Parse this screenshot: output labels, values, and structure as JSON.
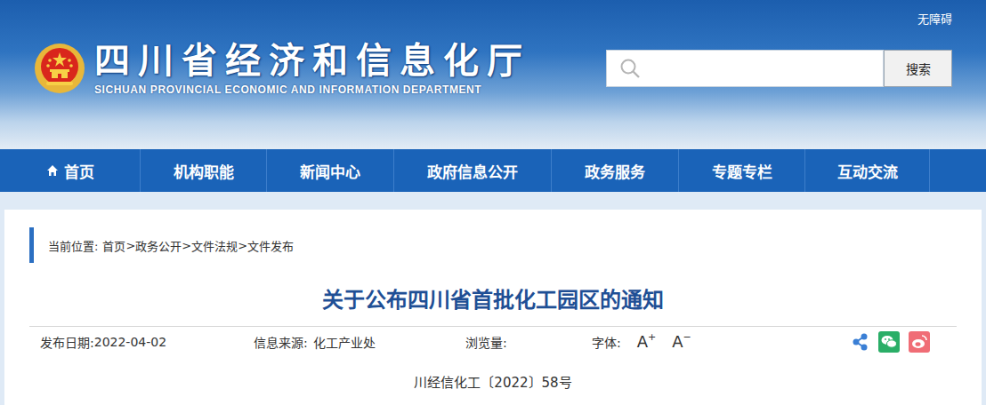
{
  "header": {
    "title": "四川省经济和信息化厅",
    "subtitle": "SICHUAN PROVINCIAL ECONOMIC AND INFORMATION DEPARTMENT",
    "accessibility": "无障碍",
    "search_button": "搜索"
  },
  "nav": {
    "items": [
      {
        "label": "首页",
        "kind": "home"
      },
      {
        "label": "机构职能",
        "kind": "text"
      },
      {
        "label": "新闻中心",
        "kind": "text"
      },
      {
        "label": "政府信息公开",
        "kind": "text"
      },
      {
        "label": "政务服务",
        "kind": "text"
      },
      {
        "label": "专题专栏",
        "kind": "text"
      },
      {
        "label": "互动交流",
        "kind": "text"
      }
    ]
  },
  "breadcrumb": {
    "label": "当前位置:",
    "separator": ">",
    "items": [
      "首页",
      "政务公开",
      "文件法规",
      "文件发布"
    ]
  },
  "article": {
    "title": "关于公布四川省首批化工园区的通知",
    "meta": {
      "date_label": "发布日期:",
      "date": "2022-04-02",
      "source_label": "信息来源:",
      "source": "化工产业处",
      "views_label": "浏览量:",
      "font_label": "字体:",
      "font_buttons": [
        {
          "letter": "A",
          "sign": "+"
        },
        {
          "letter": "A",
          "sign": "−"
        }
      ]
    },
    "doc_number": "川经信化工〔2022〕58号"
  }
}
